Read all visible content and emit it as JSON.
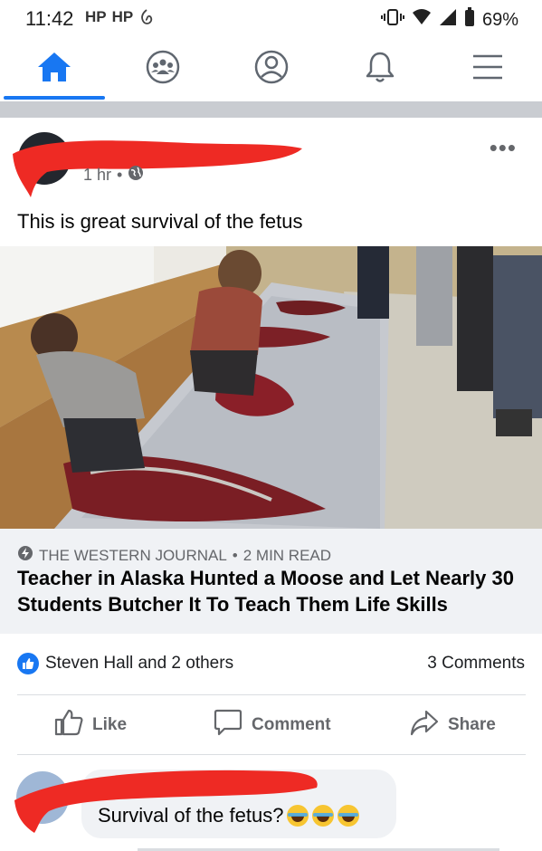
{
  "status_bar": {
    "time": "11:42",
    "left_icons": [
      "HP",
      "HP"
    ],
    "battery": "69%"
  },
  "nav": {
    "items": [
      {
        "name": "home-icon",
        "active": true
      },
      {
        "name": "groups-icon",
        "active": false
      },
      {
        "name": "profile-icon",
        "active": false
      },
      {
        "name": "bell-icon",
        "active": false
      },
      {
        "name": "menu-icon",
        "active": false
      }
    ],
    "accent_color": "#1877f2"
  },
  "post": {
    "time": "1 hr",
    "separator": "•",
    "text": "This is great survival of the fetus",
    "link": {
      "source": "THE WESTERN JOURNAL",
      "read_time": "2 MIN READ",
      "title": "Teacher in Alaska Hunted a Moose and Let Nearly 30 Students Butcher It To Teach Them Life Skills"
    },
    "reactions_text": "Steven Hall and 2 others",
    "comments_count": "3 Comments",
    "actions": {
      "like": "Like",
      "comment": "Comment",
      "share": "Share"
    }
  },
  "comment": {
    "text": "Survival of the fetus?",
    "emojis": [
      "laughing-crying",
      "laughing-crying",
      "laughing-crying"
    ]
  }
}
